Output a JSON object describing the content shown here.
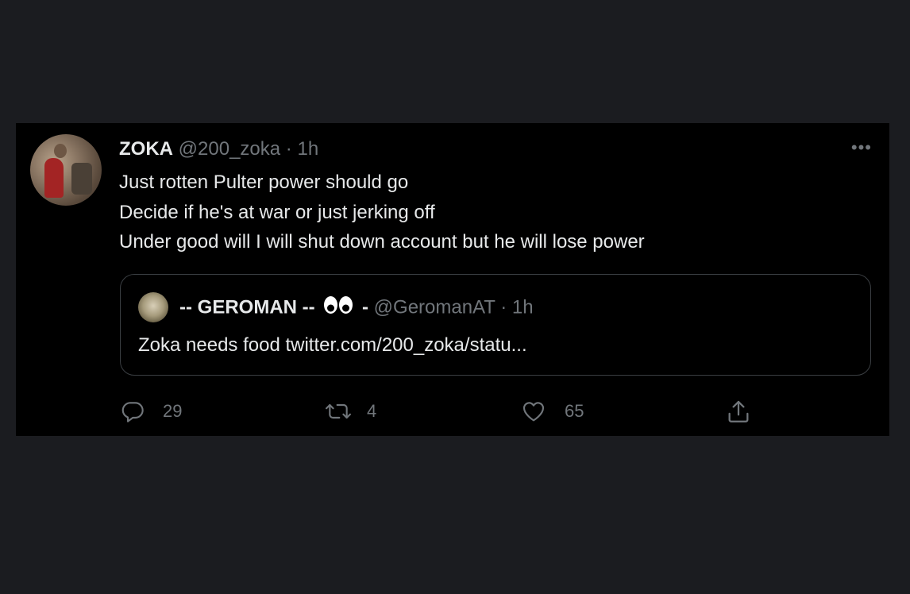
{
  "tweet": {
    "author_name": "ZOKA",
    "author_handle": "@200_zoka",
    "separator": "·",
    "time": "1h",
    "more_label": "•••",
    "lines": [
      "Just rotten Pulter power should go",
      "Decide if he's at war or just jerking off",
      "Under good will I will shut down account but he will lose power"
    ]
  },
  "quote": {
    "author_name": "-- GEROMAN --",
    "name_suffix": "-",
    "author_handle": "@GeromanAT",
    "separator": "·",
    "time": "1h",
    "text": "Zoka needs food twitter.com/200_zoka/statu..."
  },
  "actions": {
    "replies": "29",
    "retweets": "4",
    "likes": "65",
    "icons": [
      "reply-icon",
      "retweet-icon",
      "like-icon",
      "share-icon"
    ]
  },
  "colors": {
    "page_bg": "#1b1c20",
    "card_bg": "#000000",
    "text": "#e7e9ea",
    "muted": "#71767b",
    "border": "#3a3e42"
  }
}
